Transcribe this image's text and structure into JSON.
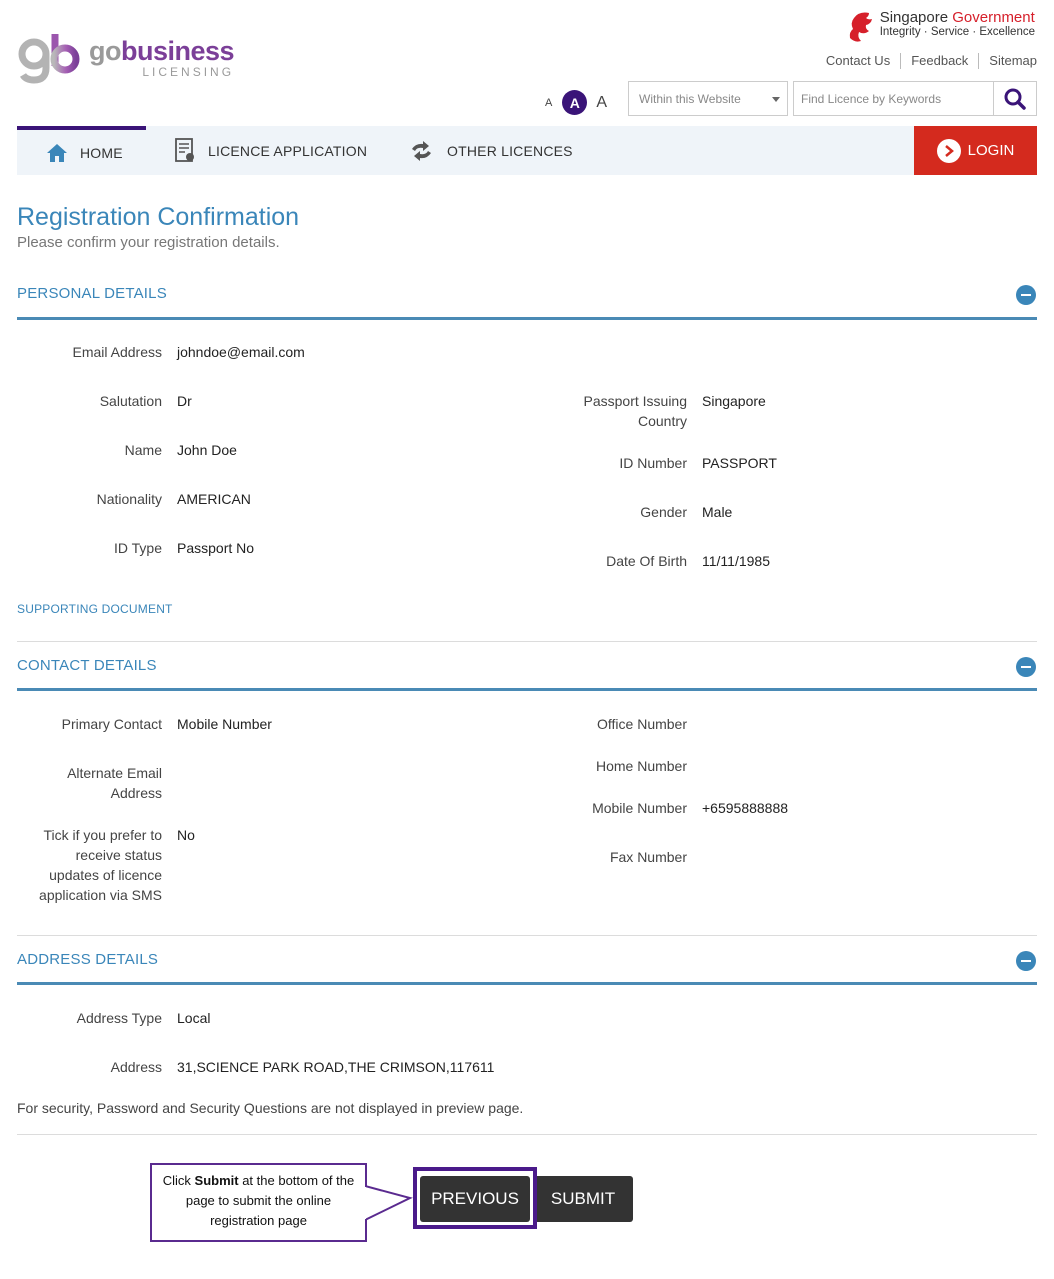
{
  "brand": {
    "logo_go": "go",
    "logo_business": "business",
    "logo_licensing": "LICENSING"
  },
  "gov": {
    "title_plain": "Singapore ",
    "title_red": "Government",
    "tagline": "Integrity · Service · Excellence"
  },
  "toplinks": [
    "Contact Us",
    "Feedback",
    "Sitemap"
  ],
  "font_size": {
    "small": "A",
    "medium": "A",
    "large": "A"
  },
  "search": {
    "scope": "Within this Website",
    "placeholder": "Find Licence by Keywords"
  },
  "nav": {
    "home": "HOME",
    "licence_application": "LICENCE APPLICATION",
    "other_licences": "OTHER LICENCES",
    "login": "LOGIN"
  },
  "page": {
    "title": "Registration Confirmation",
    "subtitle": "Please confirm your registration details."
  },
  "personal": {
    "heading": "PERSONAL DETAILS",
    "email_label": "Email Address",
    "email": "johndoe@email.com",
    "salutation_label": "Salutation",
    "salutation": "Dr",
    "name_label": "Name",
    "name": "John Doe",
    "nationality_label": "Nationality",
    "nationality": "AMERICAN",
    "id_type_label": "ID Type",
    "id_type": "Passport No",
    "passport_country_label_1": "Passport Issuing",
    "passport_country_label_2": "Country",
    "passport_country": "Singapore",
    "id_number_label": "ID Number",
    "id_number": "PASSPORT",
    "gender_label": "Gender",
    "gender": "Male",
    "dob_label": "Date Of Birth",
    "dob": "11/11/1985",
    "supporting": "SUPPORTING DOCUMENT"
  },
  "contact": {
    "heading": "CONTACT DETAILS",
    "primary_label": "Primary Contact",
    "primary": "Mobile Number",
    "alt_email_label_1": "Alternate Email",
    "alt_email_label_2": "Address",
    "sms_label_1": "Tick if you prefer to",
    "sms_label_2": "receive status",
    "sms_label_3": "updates of licence",
    "sms_label_4": "application via SMS",
    "sms": "No",
    "office_label": "Office Number",
    "home_label": "Home Number",
    "mobile_label": "Mobile Number",
    "mobile": "+6595888888",
    "fax_label": "Fax Number"
  },
  "address": {
    "heading": "ADDRESS DETAILS",
    "type_label": "Address Type",
    "type": "Local",
    "address_label": "Address",
    "address": "31,SCIENCE PARK ROAD,THE CRIMSON,117611"
  },
  "note": "For security, Password and Security Questions are not displayed in preview page.",
  "buttons": {
    "previous": "PREVIOUS",
    "submit": "SUBMIT"
  },
  "callout": {
    "pre": "Click ",
    "bold": "Submit",
    "post": " at the bottom of the page to submit the online registration page"
  },
  "colors": {
    "accent_blue": "#3a86b9",
    "brand_purple": "#3a1478",
    "login_red": "#d42a1e",
    "gov_red": "#d6202b"
  }
}
